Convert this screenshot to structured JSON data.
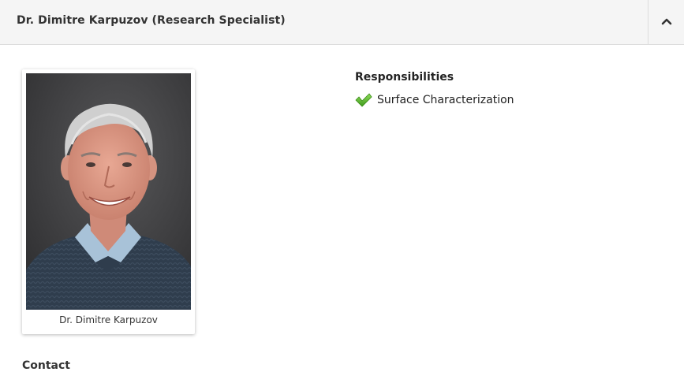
{
  "header": {
    "title": "Dr. Dimitre Karpuzov (Research Specialist)",
    "toggle_icon": "chevron-up-icon"
  },
  "profile": {
    "photo_caption": "Dr. Dimitre Karpuzov"
  },
  "responsibilities": {
    "heading": "Responsibilities",
    "items": [
      {
        "label": "Surface Characterization",
        "icon": "checkmark-icon"
      }
    ]
  },
  "contact": {
    "heading": "Contact"
  },
  "colors": {
    "header_bg": "#f5f5f5",
    "check_green": "#5cb82a"
  }
}
